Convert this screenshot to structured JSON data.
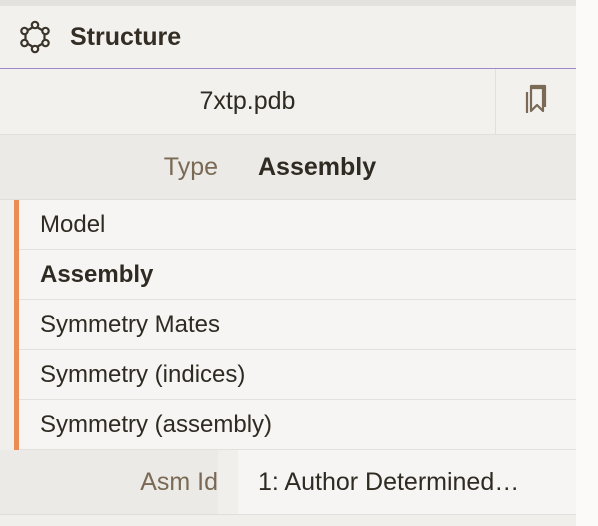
{
  "header": {
    "title": "Structure",
    "icon": "structure-icon"
  },
  "file": {
    "name": "7xtp.pdb",
    "bookmark_icon": "bookmarks-icon"
  },
  "type": {
    "label": "Type",
    "value": "Assembly"
  },
  "type_options": [
    {
      "label": "Model",
      "selected": false
    },
    {
      "label": "Assembly",
      "selected": true
    },
    {
      "label": "Symmetry Mates",
      "selected": false
    },
    {
      "label": "Symmetry (indices)",
      "selected": false
    },
    {
      "label": "Symmetry (assembly)",
      "selected": false
    }
  ],
  "asm_id": {
    "label": "Asm Id",
    "value": "1: Author Determined…"
  },
  "colors": {
    "accent_border": "#eb8c54",
    "header_underline": "#9d87c9",
    "label_text": "#7a6a55"
  }
}
